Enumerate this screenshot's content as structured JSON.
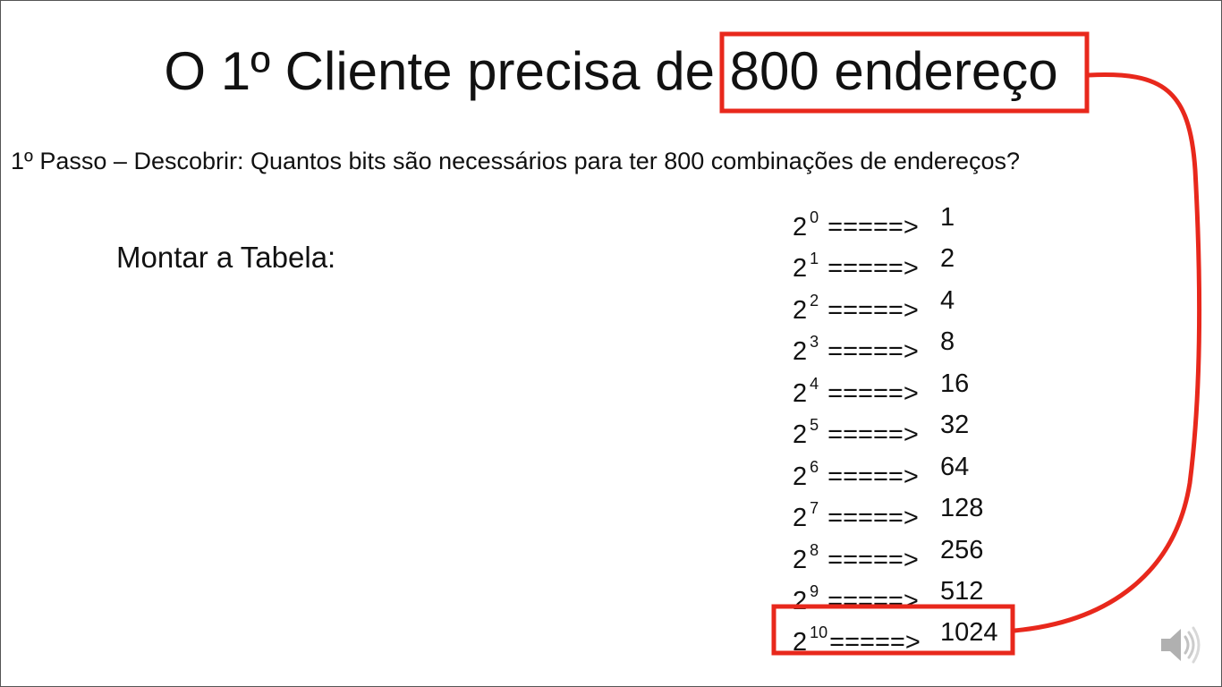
{
  "slide": {
    "title_before": "O 1º Cliente precisa de ",
    "title_highlight": "800 endereço",
    "step_text": "1º Passo – Descobrir: Quantos bits são necessários para ter 800 combinações de endereços?",
    "montar_label": "Montar a Tabela:",
    "base": "2",
    "arrow": "=====>",
    "powers": [
      {
        "exp": "0",
        "value": "1"
      },
      {
        "exp": "1",
        "value": "2"
      },
      {
        "exp": "2",
        "value": "4"
      },
      {
        "exp": "3",
        "value": "8"
      },
      {
        "exp": "4",
        "value": "16"
      },
      {
        "exp": "5",
        "value": "32"
      },
      {
        "exp": "6",
        "value": "64"
      },
      {
        "exp": "7",
        "value": "128"
      },
      {
        "exp": "8",
        "value": "256"
      },
      {
        "exp": "9",
        "value": "512"
      },
      {
        "exp": "10",
        "value": "1024"
      }
    ]
  },
  "colors": {
    "highlight": "#e8281c",
    "text": "#111111",
    "speaker_icon": "#b0b0b0"
  },
  "icons": {
    "speaker": "speaker-icon"
  }
}
